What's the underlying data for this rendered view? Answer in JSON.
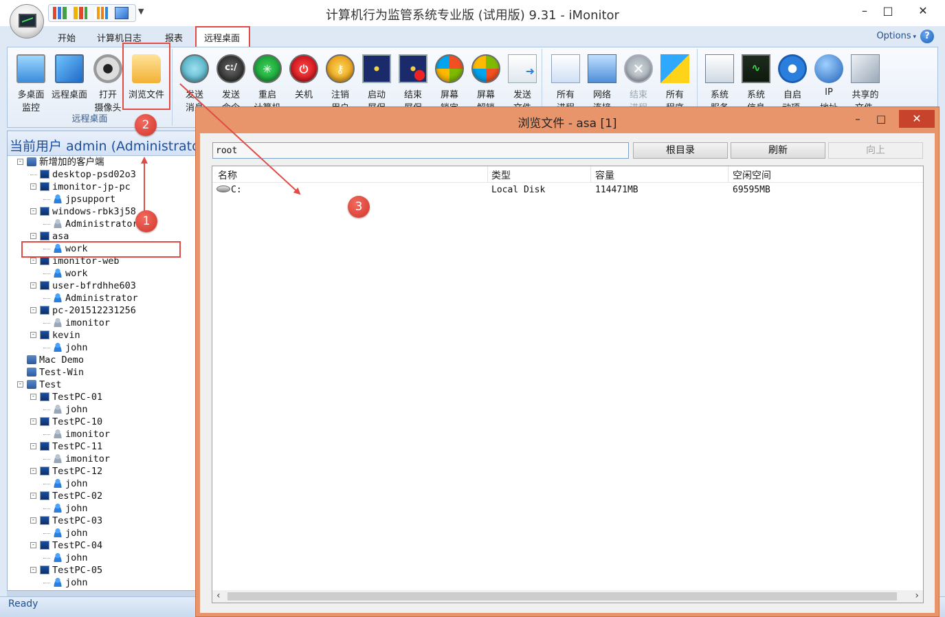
{
  "window": {
    "title": "计算机行为监管系统专业版 (试用版) 9.31 - iMonitor",
    "minimize": "–",
    "maximize": "□",
    "close": "✕"
  },
  "ribbon_tabs": [
    "开始",
    "计算机日志",
    "报表",
    "远程桌面"
  ],
  "options_label": "Options",
  "help_label": "?",
  "ribbon": {
    "group1": {
      "label": "远程桌面",
      "buttons": [
        {
          "l1": "多桌面",
          "l2": "监控",
          "icon": "multi-desktop-icon"
        },
        {
          "l1": "远程桌面",
          "l2": "",
          "icon": "remote-desktop-icon"
        },
        {
          "l1": "打开",
          "l2": "摄像头",
          "icon": "webcam-icon"
        },
        {
          "l1": "浏览文件",
          "l2": "",
          "icon": "browse-files-icon"
        }
      ]
    },
    "group2": {
      "buttons": [
        {
          "l1": "发送",
          "l2": "消息",
          "icon": "send-message-icon"
        },
        {
          "l1": "发送",
          "l2": "命令",
          "icon": "send-command-icon"
        },
        {
          "l1": "重启",
          "l2": "计算机",
          "icon": "restart-icon"
        },
        {
          "l1": "关机",
          "l2": "",
          "icon": "shutdown-icon"
        },
        {
          "l1": "注销",
          "l2": "用户",
          "icon": "logoff-icon"
        },
        {
          "l1": "启动",
          "l2": "屏保",
          "icon": "start-screensaver-icon"
        },
        {
          "l1": "结束",
          "l2": "屏保",
          "icon": "stop-screensaver-icon"
        },
        {
          "l1": "屏幕",
          "l2": "锁定",
          "icon": "lock-screen-icon"
        },
        {
          "l1": "屏幕",
          "l2": "解锁",
          "icon": "unlock-screen-icon"
        },
        {
          "l1": "发送",
          "l2": "文件",
          "icon": "send-file-icon"
        }
      ]
    },
    "group3": {
      "buttons": [
        {
          "l1": "所有",
          "l2": "进程",
          "icon": "processes-icon"
        },
        {
          "l1": "网络",
          "l2": "连接",
          "icon": "network-icon"
        },
        {
          "l1": "结束",
          "l2": "进程",
          "icon": "kill-process-icon"
        },
        {
          "l1": "所有",
          "l2": "程序",
          "icon": "programs-icon"
        }
      ]
    },
    "group4": {
      "buttons": [
        {
          "l1": "系统",
          "l2": "服务",
          "icon": "services-icon"
        },
        {
          "l1": "系统",
          "l2": "信息",
          "icon": "sysinfo-icon"
        },
        {
          "l1": "自启",
          "l2": "动项",
          "icon": "startup-icon"
        },
        {
          "l1": "IP",
          "l2": "地址",
          "icon": "ip-icon"
        },
        {
          "l1": "共享的",
          "l2": "文件",
          "icon": "shared-files-icon"
        }
      ]
    }
  },
  "left_panel": {
    "current_user": "当前用户 admin (Administrator)",
    "tree": [
      {
        "text": "新增加的客户端",
        "type": "net",
        "level": 0,
        "exp": "-"
      },
      {
        "text": "desktop-psd02o3",
        "type": "pc",
        "level": 1,
        "exp": ""
      },
      {
        "text": "imonitor-jp-pc",
        "type": "pc",
        "level": 1,
        "exp": "-"
      },
      {
        "text": "jpsupport",
        "type": "user",
        "level": 2,
        "exp": ""
      },
      {
        "text": "windows-rbk3j58",
        "type": "pc",
        "level": 1,
        "exp": "-"
      },
      {
        "text": "Administrator",
        "type": "user-gray",
        "level": 2,
        "exp": ""
      },
      {
        "text": "asa",
        "type": "pc",
        "level": 1,
        "exp": "-"
      },
      {
        "text": "work",
        "type": "user",
        "level": 2,
        "exp": ""
      },
      {
        "text": "imonitor-web",
        "type": "pc",
        "level": 1,
        "exp": "-"
      },
      {
        "text": "work",
        "type": "user",
        "level": 2,
        "exp": ""
      },
      {
        "text": "user-bfrdhhe603",
        "type": "pc",
        "level": 1,
        "exp": "-"
      },
      {
        "text": "Administrator",
        "type": "user",
        "level": 2,
        "exp": ""
      },
      {
        "text": "pc-201512231256",
        "type": "pc",
        "level": 1,
        "exp": "-"
      },
      {
        "text": "imonitor",
        "type": "user-gray",
        "level": 2,
        "exp": ""
      },
      {
        "text": "kevin",
        "type": "pc",
        "level": 1,
        "exp": "-"
      },
      {
        "text": "john",
        "type": "user",
        "level": 2,
        "exp": ""
      },
      {
        "text": "Mac Demo",
        "type": "net",
        "level": 0,
        "exp": ""
      },
      {
        "text": "Test-Win",
        "type": "net",
        "level": 0,
        "exp": ""
      },
      {
        "text": "Test",
        "type": "net",
        "level": 0,
        "exp": "-"
      },
      {
        "text": "TestPC-01",
        "type": "pc",
        "level": 1,
        "exp": "-"
      },
      {
        "text": "john",
        "type": "user-gray",
        "level": 2,
        "exp": ""
      },
      {
        "text": "TestPC-10",
        "type": "pc",
        "level": 1,
        "exp": "-"
      },
      {
        "text": "imonitor",
        "type": "user-gray",
        "level": 2,
        "exp": ""
      },
      {
        "text": "TestPC-11",
        "type": "pc",
        "level": 1,
        "exp": "-"
      },
      {
        "text": "imonitor",
        "type": "user-gray",
        "level": 2,
        "exp": ""
      },
      {
        "text": "TestPC-12",
        "type": "pc",
        "level": 1,
        "exp": "-"
      },
      {
        "text": "john",
        "type": "user",
        "level": 2,
        "exp": ""
      },
      {
        "text": "TestPC-02",
        "type": "pc",
        "level": 1,
        "exp": "-"
      },
      {
        "text": "john",
        "type": "user",
        "level": 2,
        "exp": ""
      },
      {
        "text": "TestPC-03",
        "type": "pc",
        "level": 1,
        "exp": "-"
      },
      {
        "text": "john",
        "type": "user",
        "level": 2,
        "exp": ""
      },
      {
        "text": "TestPC-04",
        "type": "pc",
        "level": 1,
        "exp": "-"
      },
      {
        "text": "john",
        "type": "user",
        "level": 2,
        "exp": ""
      },
      {
        "text": "TestPC-05",
        "type": "pc",
        "level": 1,
        "exp": "-"
      },
      {
        "text": "john",
        "type": "user",
        "level": 2,
        "exp": ""
      }
    ]
  },
  "status": "Ready",
  "dialog": {
    "title": "浏览文件 - asa [1]",
    "path_value": "root",
    "buttons": {
      "root": "根目录",
      "refresh": "刷新",
      "up": "向上"
    },
    "columns": [
      "名称",
      "类型",
      "容量",
      "空闲空间"
    ],
    "rows": [
      {
        "name": "C:",
        "type": "Local Disk",
        "capacity": "114471MB",
        "free": "69595MB"
      }
    ]
  },
  "annotations": {
    "steps": [
      "1",
      "2",
      "3"
    ],
    "color": "#e04b45"
  }
}
